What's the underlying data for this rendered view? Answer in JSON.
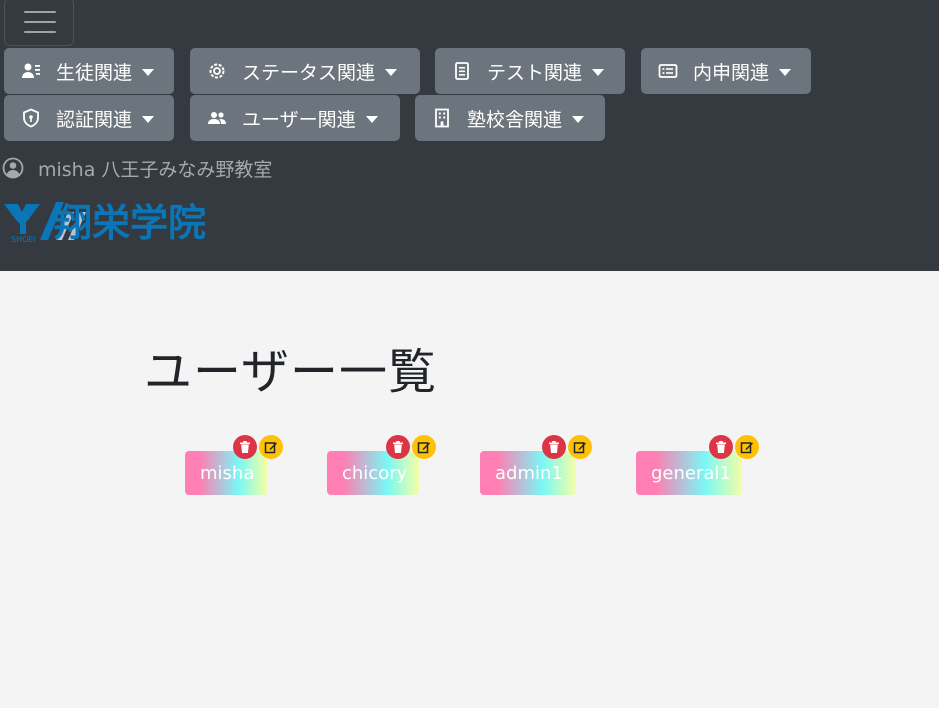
{
  "navbar": {
    "menus": [
      {
        "label": "生徒関連",
        "icon": "student-list-icon"
      },
      {
        "label": "ステータス関連",
        "icon": "gear-icon"
      },
      {
        "label": "テスト関連",
        "icon": "document-icon"
      },
      {
        "label": "内申関連",
        "icon": "card-list-icon"
      },
      {
        "label": "認証関連",
        "icon": "shield-icon"
      },
      {
        "label": "ユーザー関連",
        "icon": "users-icon"
      },
      {
        "label": "塾校舎関連",
        "icon": "building-icon"
      }
    ],
    "current_user": "misha 八王子みなみ野教室",
    "logo": {
      "brand": "翔栄学院",
      "sub": "SHOEI"
    }
  },
  "main": {
    "title": "ユーザー一覧",
    "users": [
      {
        "name": "misha"
      },
      {
        "name": "chicory"
      },
      {
        "name": "admin1"
      },
      {
        "name": "general1"
      }
    ]
  },
  "colors": {
    "navbar_bg": "#343a40",
    "menu_btn_bg": "#6c757d",
    "delete": "#dc3545",
    "edit": "#ffc107",
    "logo_blue": "#0a76b8"
  }
}
